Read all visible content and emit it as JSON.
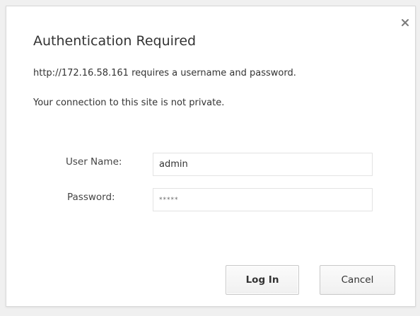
{
  "dialog": {
    "title": "Authentication Required",
    "message_line1": "http://172.16.58.161 requires a username and password.",
    "message_line2": "Your connection to this site is not private.",
    "close_icon": "close-icon"
  },
  "form": {
    "username_label": "User Name:",
    "username_value": "admin",
    "password_label": "Password:",
    "password_display": "*****"
  },
  "buttons": {
    "login_label": "Log In",
    "cancel_label": "Cancel"
  }
}
